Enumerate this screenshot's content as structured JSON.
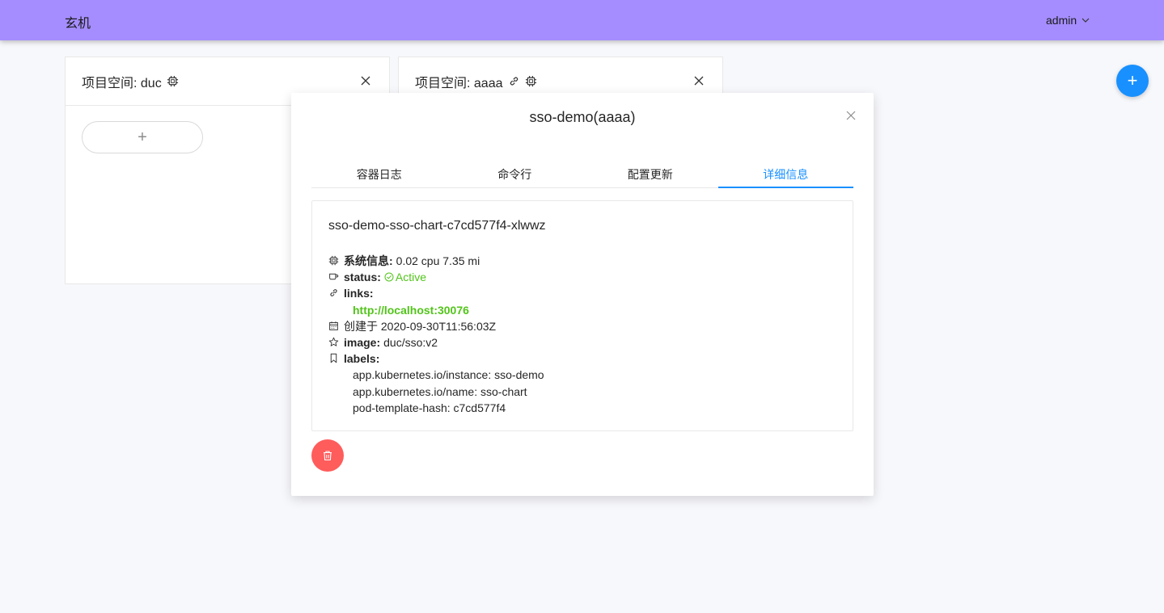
{
  "header": {
    "app_title": "玄机",
    "user": "admin"
  },
  "cards": [
    {
      "title": "项目空间: duc",
      "add_label": "+"
    },
    {
      "title": "项目空间: aaaa"
    }
  ],
  "fab_label": "+",
  "modal": {
    "title": "sso-demo(aaaa)",
    "tabs": [
      "容器日志",
      "命令行",
      "配置更新",
      "详细信息"
    ],
    "active_tab": 3,
    "pod_name": "sso-demo-sso-chart-c7cd577f4-xlwwz",
    "system_info_label": "系统信息:",
    "system_info_value": "0.02 cpu 7.35 mi",
    "status_label": "status:",
    "status_value": "Active",
    "links_label": "links:",
    "link_url": "http://localhost:30076",
    "created_text": "创建于 2020-09-30T11:56:03Z",
    "image_label": "image:",
    "image_value": "duc/sso:v2",
    "labels_label": "labels:",
    "labels": [
      "app.kubernetes.io/instance: sso-demo",
      "app.kubernetes.io/name: sso-chart",
      "pod-template-hash: c7cd577f4"
    ]
  },
  "colors": {
    "topbar": "#a58dff",
    "accent": "#1890ff",
    "success": "#52c41a",
    "danger": "#ff5c5c"
  },
  "icons": [
    "chip-icon",
    "link-icon",
    "close-icon",
    "chevron-down-icon",
    "cup-icon",
    "check-circle-icon",
    "calendar-icon",
    "star-icon",
    "bookmark-icon",
    "trash-icon"
  ]
}
